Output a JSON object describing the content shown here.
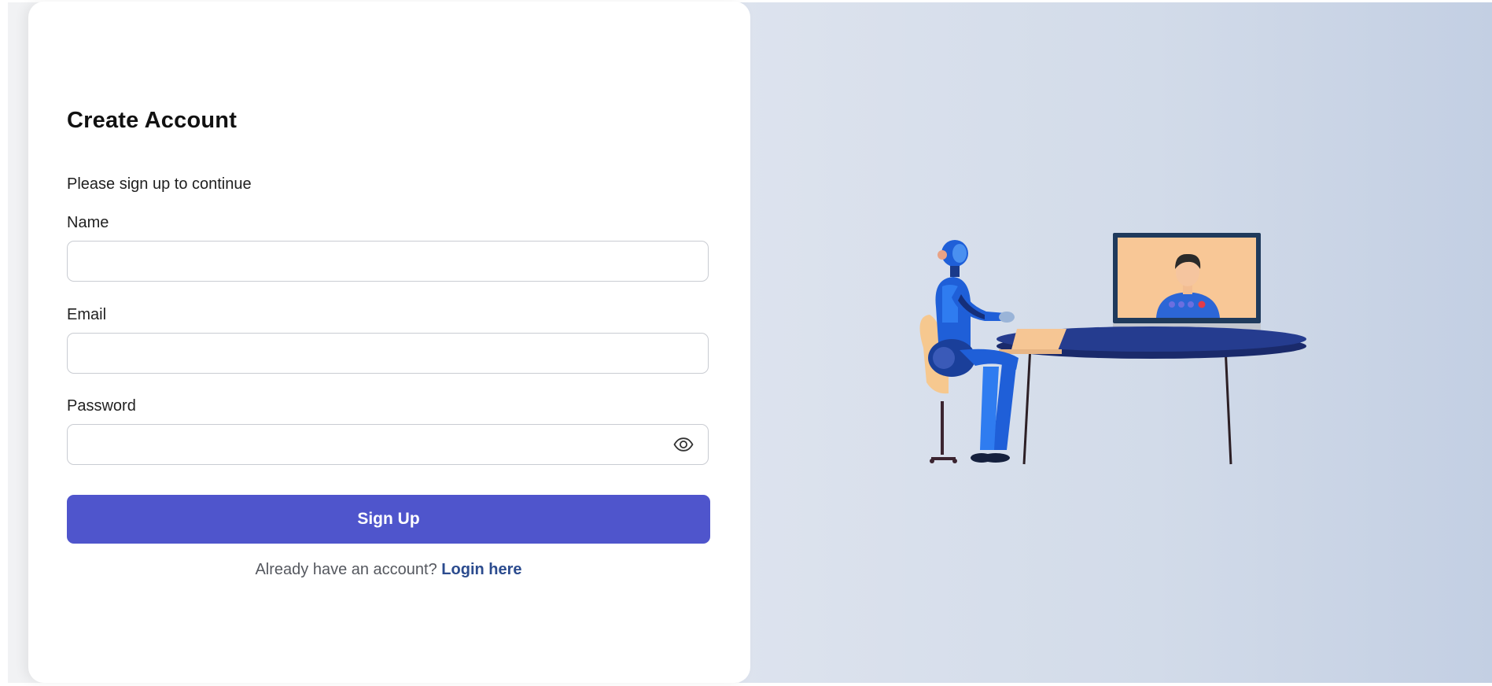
{
  "form": {
    "title": "Create Account",
    "subtitle": "Please sign up to continue",
    "fields": {
      "name": {
        "label": "Name",
        "value": "",
        "placeholder": ""
      },
      "email": {
        "label": "Email",
        "value": "",
        "placeholder": ""
      },
      "password": {
        "label": "Password",
        "value": "",
        "placeholder": ""
      }
    },
    "password_toggle_icon": "eye-icon",
    "submit_label": "Sign Up",
    "login_prompt": "Already have an account?",
    "login_link_label": "Login here"
  },
  "colors": {
    "primary_button": "#4f55cc",
    "link": "#2b4b8e",
    "panel_gradient_start": "#dde3ee",
    "panel_gradient_end": "#c3cfe3"
  },
  "illustration": {
    "subject": "robot-video-call"
  }
}
